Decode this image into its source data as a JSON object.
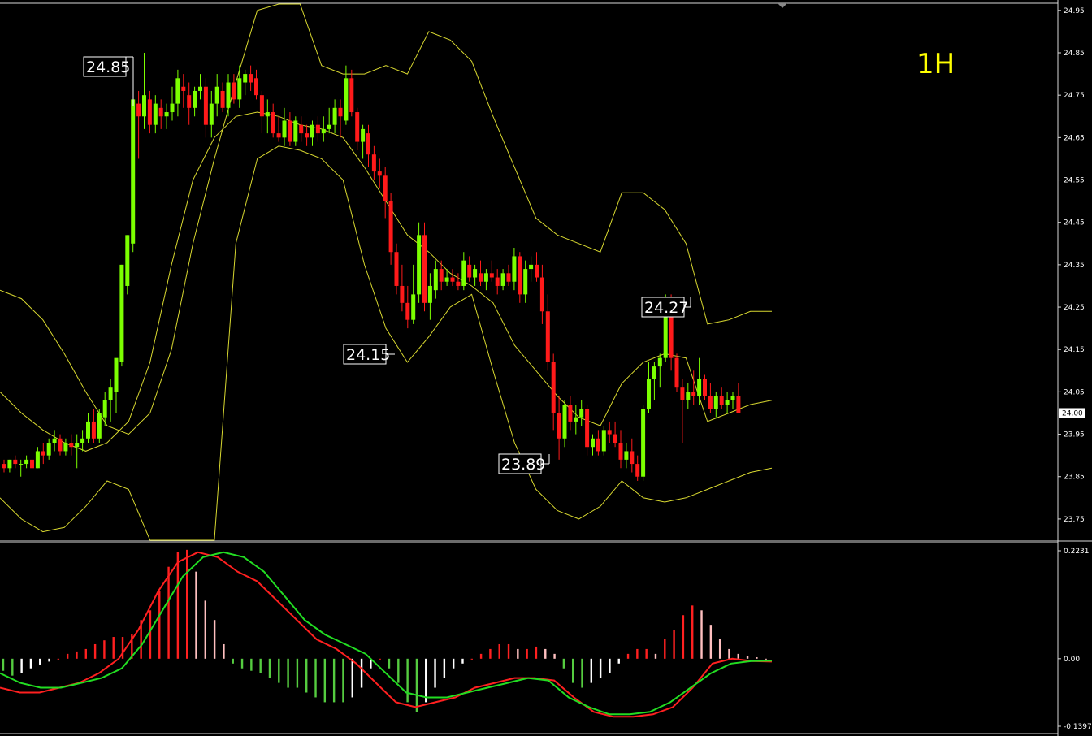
{
  "timeframe_label": "1H",
  "current_price_label": "24.00",
  "colors": {
    "background": "#000000",
    "bull": "#7cff00",
    "bear": "#ff1a1a",
    "band": "#d8d830",
    "frame": "#d9d9d9",
    "price_line": "#b0b0b0",
    "hist_pos_up": "#ff2020",
    "hist_pos_down": "#ffc0c0",
    "hist_neg_down": "#55cc40",
    "hist_neg_up": "#ffffff",
    "macd_line": "#ff2020",
    "signal_line": "#22dd22",
    "timeframe_text": "#ffff00"
  },
  "chart_data": [
    {
      "type": "candlestick",
      "title": "",
      "ylim": [
        23.72,
        25.0
      ],
      "y_tick_labels": [
        "24.95",
        "24.85",
        "24.75",
        "24.65",
        "24.55",
        "24.45",
        "24.35",
        "24.25",
        "24.15",
        "24.05",
        "23.95",
        "23.85",
        "23.75"
      ],
      "current_price": 24.0,
      "annotations": [
        {
          "label": "24.85",
          "bar": 25
        },
        {
          "label": "24.15",
          "bar": 74
        },
        {
          "label": "23.89",
          "bar": 104
        },
        {
          "label": "24.27",
          "bar": 131
        }
      ],
      "candles": [
        [
          23.88,
          23.89,
          23.86,
          23.87
        ],
        [
          23.87,
          23.89,
          23.86,
          23.89
        ],
        [
          23.89,
          23.9,
          23.87,
          23.88
        ],
        [
          23.88,
          23.89,
          23.85,
          23.88
        ],
        [
          23.88,
          23.9,
          23.87,
          23.89
        ],
        [
          23.89,
          23.9,
          23.86,
          23.87
        ],
        [
          23.87,
          23.92,
          23.87,
          23.91
        ],
        [
          23.91,
          23.93,
          23.88,
          23.9
        ],
        [
          23.9,
          23.94,
          23.89,
          23.93
        ],
        [
          23.93,
          23.96,
          23.91,
          23.94
        ],
        [
          23.94,
          23.95,
          23.9,
          23.91
        ],
        [
          23.91,
          23.94,
          23.9,
          23.93
        ],
        [
          23.93,
          23.95,
          23.9,
          23.92
        ],
        [
          23.92,
          23.95,
          23.87,
          23.93
        ],
        [
          23.93,
          23.96,
          23.91,
          23.94
        ],
        [
          23.94,
          24.0,
          23.93,
          23.98
        ],
        [
          23.98,
          24.01,
          23.93,
          23.94
        ],
        [
          23.94,
          24.01,
          23.93,
          24.0
        ],
        [
          23.99,
          24.05,
          23.97,
          24.03
        ],
        [
          24.03,
          24.08,
          23.98,
          24.06
        ],
        [
          24.05,
          24.1,
          24.0,
          24.13
        ],
        [
          24.12,
          24.35,
          24.11,
          24.35
        ],
        [
          24.3,
          24.42,
          24.28,
          24.42
        ],
        [
          24.4,
          24.6,
          24.38,
          24.74
        ],
        [
          24.73,
          24.76,
          24.6,
          24.7
        ],
        [
          24.7,
          24.85,
          24.67,
          24.75
        ],
        [
          24.74,
          24.76,
          24.66,
          24.68
        ],
        [
          24.68,
          24.75,
          24.66,
          24.73
        ],
        [
          24.72,
          24.74,
          24.67,
          24.7
        ],
        [
          24.7,
          24.73,
          24.67,
          24.71
        ],
        [
          24.71,
          24.77,
          24.69,
          24.73
        ],
        [
          24.73,
          24.81,
          24.7,
          24.79
        ],
        [
          24.77,
          24.8,
          24.72,
          24.76
        ],
        [
          24.75,
          24.78,
          24.68,
          24.72
        ],
        [
          24.72,
          24.77,
          24.7,
          24.76
        ],
        [
          24.76,
          24.8,
          24.74,
          24.77
        ],
        [
          24.77,
          24.79,
          24.65,
          24.68
        ],
        [
          24.68,
          24.76,
          24.65,
          24.73
        ],
        [
          24.73,
          24.8,
          24.7,
          24.77
        ],
        [
          24.76,
          24.78,
          24.71,
          24.72
        ],
        [
          24.72,
          24.8,
          24.7,
          24.78
        ],
        [
          24.78,
          24.8,
          24.73,
          24.74
        ],
        [
          24.74,
          24.82,
          24.72,
          24.79
        ],
        [
          24.78,
          24.81,
          24.75,
          24.8
        ],
        [
          24.8,
          24.82,
          24.76,
          24.78
        ],
        [
          24.79,
          24.81,
          24.74,
          24.75
        ],
        [
          24.75,
          24.76,
          24.66,
          24.7
        ],
        [
          24.7,
          24.74,
          24.66,
          24.71
        ],
        [
          24.71,
          24.73,
          24.65,
          24.66
        ],
        [
          24.66,
          24.7,
          24.64,
          24.65
        ],
        [
          24.65,
          24.72,
          24.63,
          24.69
        ],
        [
          24.69,
          24.71,
          24.63,
          24.64
        ],
        [
          24.64,
          24.7,
          24.63,
          24.69
        ],
        [
          24.68,
          24.7,
          24.64,
          24.66
        ],
        [
          24.66,
          24.68,
          24.63,
          24.65
        ],
        [
          24.65,
          24.69,
          24.63,
          24.68
        ],
        [
          24.68,
          24.7,
          24.64,
          24.66
        ],
        [
          24.66,
          24.7,
          24.64,
          24.67
        ],
        [
          24.67,
          24.72,
          24.66,
          24.68
        ],
        [
          24.68,
          24.74,
          24.66,
          24.72
        ],
        [
          24.72,
          24.74,
          24.65,
          24.7
        ],
        [
          24.69,
          24.82,
          24.68,
          24.79
        ],
        [
          24.79,
          24.81,
          24.7,
          24.71
        ],
        [
          24.71,
          24.72,
          24.62,
          24.64
        ],
        [
          24.64,
          24.68,
          24.6,
          24.67
        ],
        [
          24.66,
          24.68,
          24.58,
          24.61
        ],
        [
          24.61,
          24.63,
          24.55,
          24.57
        ],
        [
          24.57,
          24.6,
          24.53,
          24.56
        ],
        [
          24.56,
          24.58,
          24.46,
          24.5
        ],
        [
          24.5,
          24.52,
          24.35,
          24.38
        ],
        [
          24.38,
          24.4,
          24.28,
          24.3
        ],
        [
          24.3,
          24.35,
          24.24,
          24.26
        ],
        [
          24.26,
          24.3,
          24.2,
          24.22
        ],
        [
          24.22,
          24.35,
          24.21,
          24.28
        ],
        [
          24.28,
          24.45,
          24.26,
          24.42
        ],
        [
          24.42,
          24.45,
          24.24,
          24.26
        ],
        [
          24.26,
          24.33,
          24.22,
          24.3
        ],
        [
          24.29,
          24.36,
          24.27,
          24.34
        ],
        [
          24.34,
          24.36,
          24.29,
          24.31
        ],
        [
          24.31,
          24.34,
          24.3,
          24.32
        ],
        [
          24.32,
          24.34,
          24.3,
          24.31
        ],
        [
          24.31,
          24.33,
          24.29,
          24.3
        ],
        [
          24.3,
          24.38,
          24.29,
          24.36
        ],
        [
          24.35,
          24.37,
          24.31,
          24.32
        ],
        [
          24.32,
          24.35,
          24.3,
          24.34
        ],
        [
          24.33,
          24.36,
          24.3,
          24.31
        ],
        [
          24.31,
          24.34,
          24.29,
          24.33
        ],
        [
          24.33,
          24.36,
          24.31,
          24.32
        ],
        [
          24.32,
          24.34,
          24.28,
          24.3
        ],
        [
          24.3,
          24.34,
          24.29,
          24.33
        ],
        [
          24.33,
          24.35,
          24.3,
          24.31
        ],
        [
          24.31,
          24.39,
          24.29,
          24.37
        ],
        [
          24.37,
          24.38,
          24.26,
          24.28
        ],
        [
          24.28,
          24.36,
          24.26,
          24.34
        ],
        [
          24.34,
          24.37,
          24.31,
          24.35
        ],
        [
          24.35,
          24.38,
          24.31,
          24.32
        ],
        [
          24.32,
          24.35,
          24.21,
          24.24
        ],
        [
          24.24,
          24.28,
          24.1,
          24.12
        ],
        [
          24.12,
          24.14,
          23.96,
          24.0
        ],
        [
          24.0,
          24.04,
          23.89,
          23.94
        ],
        [
          23.94,
          24.03,
          23.92,
          24.02
        ],
        [
          24.02,
          24.04,
          23.96,
          23.98
        ],
        [
          23.98,
          24.02,
          23.95,
          23.99
        ],
        [
          23.99,
          24.03,
          23.97,
          24.01
        ],
        [
          24.01,
          24.02,
          23.9,
          23.92
        ],
        [
          23.92,
          23.95,
          23.9,
          23.94
        ],
        [
          23.94,
          23.96,
          23.9,
          23.91
        ],
        [
          23.91,
          23.97,
          23.9,
          23.96
        ],
        [
          23.96,
          23.98,
          23.93,
          23.95
        ],
        [
          23.95,
          23.98,
          23.92,
          23.93
        ],
        [
          23.93,
          23.96,
          23.87,
          23.89
        ],
        [
          23.89,
          23.93,
          23.87,
          23.91
        ],
        [
          23.91,
          23.94,
          23.86,
          23.88
        ],
        [
          23.88,
          23.9,
          23.84,
          23.85
        ],
        [
          23.85,
          24.02,
          23.84,
          24.01
        ],
        [
          24.01,
          24.12,
          24.0,
          24.08
        ],
        [
          24.08,
          24.12,
          24.03,
          24.11
        ],
        [
          24.11,
          24.14,
          24.06,
          24.13
        ],
        [
          24.13,
          24.28,
          24.12,
          24.27
        ],
        [
          24.27,
          24.28,
          24.1,
          24.13
        ],
        [
          24.13,
          24.14,
          24.05,
          24.06
        ],
        [
          24.06,
          24.08,
          23.93,
          24.03
        ],
        [
          24.03,
          24.07,
          24.01,
          24.05
        ],
        [
          24.05,
          24.1,
          24.02,
          24.04
        ],
        [
          24.04,
          24.13,
          24.02,
          24.08
        ],
        [
          24.08,
          24.09,
          24.03,
          24.04
        ],
        [
          24.04,
          24.07,
          24.0,
          24.01
        ],
        [
          24.01,
          24.05,
          23.99,
          24.04
        ],
        [
          24.04,
          24.06,
          24.01,
          24.02
        ],
        [
          24.02,
          24.05,
          24.0,
          24.03
        ],
        [
          24.03,
          24.05,
          24.01,
          24.04
        ],
        [
          24.04,
          24.07,
          24.0,
          24.0
        ]
      ],
      "series": [
        {
          "values_upper": [
            24.29,
            24.27,
            24.22,
            24.14,
            24.05,
            23.97,
            23.95,
            24.0,
            24.15,
            24.4,
            24.6,
            24.78,
            24.95,
            25.1,
            25.1,
            24.82,
            24.8,
            24.8,
            24.82,
            24.8,
            24.9,
            24.88,
            24.83,
            24.7,
            24.58,
            24.46,
            24.42,
            24.4,
            24.38,
            24.52,
            24.52,
            24.48,
            24.4,
            24.21,
            24.22,
            24.24,
            24.24
          ]
        },
        {
          "values_middle": [
            24.05,
            24.0,
            23.96,
            23.93,
            23.91,
            23.93,
            23.98,
            24.12,
            24.35,
            24.55,
            24.65,
            24.7,
            24.71,
            24.7,
            24.68,
            24.67,
            24.65,
            24.58,
            24.5,
            24.42,
            24.38,
            24.33,
            24.3,
            24.26,
            24.16,
            24.1,
            24.04,
            23.99,
            23.97,
            24.07,
            24.12,
            24.14,
            24.13,
            23.98,
            24.0,
            24.02,
            24.03
          ]
        },
        {
          "values_lower": [
            23.8,
            23.75,
            23.72,
            23.73,
            23.78,
            23.84,
            23.82,
            23.7,
            23.5,
            23.4,
            23.6,
            24.4,
            24.6,
            24.63,
            24.62,
            24.6,
            24.55,
            24.35,
            24.2,
            24.12,
            24.18,
            24.25,
            24.28,
            24.1,
            23.93,
            23.82,
            23.77,
            23.75,
            23.78,
            23.84,
            23.8,
            23.79,
            23.8,
            23.82,
            23.84,
            23.86,
            23.87
          ]
        }
      ]
    },
    {
      "type": "bar",
      "title": "",
      "ylim": [
        -0.1397,
        0.2231
      ],
      "y_tick_labels": [
        "0.2231",
        "0.00",
        "-0.1397"
      ],
      "series": [
        {
          "name": "",
          "histogram": [
            -0.025,
            -0.035,
            -0.03,
            -0.02,
            -0.012,
            -0.006,
            0.0,
            0.01,
            0.015,
            0.02,
            0.03,
            0.038,
            0.045,
            0.045,
            0.05,
            0.08,
            0.1,
            0.14,
            0.19,
            0.22,
            0.225,
            0.18,
            0.12,
            0.08,
            0.03,
            -0.01,
            -0.02,
            -0.025,
            -0.03,
            -0.04,
            -0.05,
            -0.06,
            -0.06,
            -0.07,
            -0.08,
            -0.09,
            -0.09,
            -0.09,
            -0.08,
            -0.06,
            -0.02,
            0.0,
            -0.02,
            -0.05,
            -0.09,
            -0.11,
            -0.09,
            -0.06,
            -0.04,
            -0.02,
            -0.01,
            0.0,
            0.01,
            0.02,
            0.03,
            0.03,
            0.02,
            0.02,
            0.025,
            0.02,
            0.01,
            -0.02,
            -0.05,
            -0.06,
            -0.05,
            -0.04,
            -0.03,
            -0.01,
            0.01,
            0.02,
            0.02,
            0.01,
            0.04,
            0.06,
            0.09,
            0.11,
            0.1,
            0.07,
            0.04,
            0.02,
            0.01,
            0.005,
            0.003,
            0.0
          ]
        },
        {
          "name": "",
          "macd": [
            -0.06,
            -0.07,
            -0.07,
            -0.06,
            -0.05,
            -0.03,
            0.0,
            0.06,
            0.14,
            0.2,
            0.22,
            0.21,
            0.18,
            0.16,
            0.12,
            0.08,
            0.04,
            0.02,
            -0.01,
            -0.05,
            -0.09,
            -0.1,
            -0.09,
            -0.08,
            -0.06,
            -0.05,
            -0.04,
            -0.04,
            -0.045,
            -0.08,
            -0.11,
            -0.12,
            -0.12,
            -0.115,
            -0.1,
            -0.06,
            -0.01,
            0.0,
            -0.005,
            -0.006
          ]
        },
        {
          "name": "",
          "signal": [
            -0.03,
            -0.05,
            -0.06,
            -0.06,
            -0.05,
            -0.04,
            -0.02,
            0.03,
            0.1,
            0.17,
            0.21,
            0.22,
            0.21,
            0.18,
            0.13,
            0.08,
            0.05,
            0.03,
            0.01,
            -0.03,
            -0.07,
            -0.08,
            -0.08,
            -0.07,
            -0.06,
            -0.05,
            -0.04,
            -0.045,
            -0.08,
            -0.1,
            -0.115,
            -0.115,
            -0.11,
            -0.09,
            -0.06,
            -0.03,
            -0.01,
            -0.005,
            -0.004
          ]
        }
      ]
    }
  ]
}
